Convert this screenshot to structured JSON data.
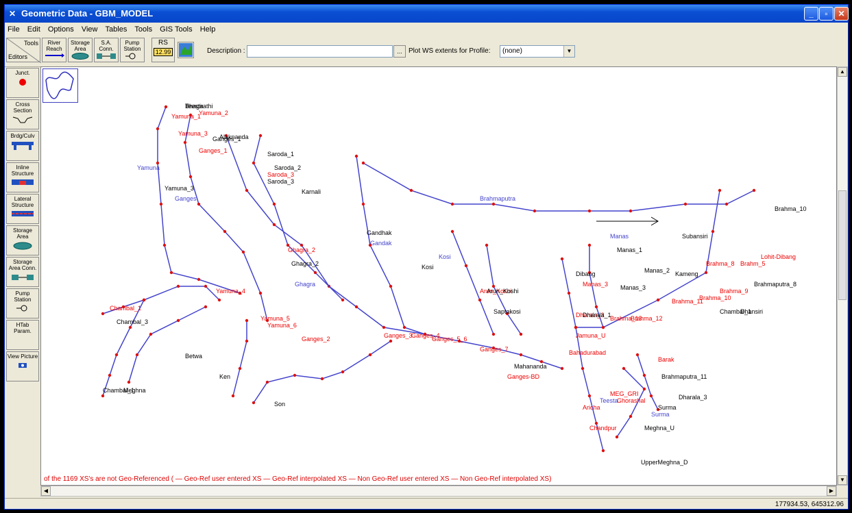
{
  "window": {
    "title": "Geometric Data - GBM_MODEL"
  },
  "menu": [
    "File",
    "Edit",
    "Options",
    "View",
    "Tables",
    "Tools",
    "GIS Tools",
    "Help"
  ],
  "toolbar": {
    "tools_label": "Tools",
    "editors_label": "Editors",
    "river_reach": "River Reach",
    "storage_area": "Storage Area",
    "sa_conn": "S.A. Conn.",
    "pump_station": "Pump Station",
    "rs": "RS",
    "rs_value": "12.99",
    "description_label": "Description :",
    "description_value": "",
    "desc_button": "...",
    "plot_ws_label": "Plot WS extents for Profile:",
    "profile_value": "(none)"
  },
  "sidebar": {
    "junct": "Junct.",
    "cross_section": "Cross Section",
    "brdg_culv": "Brdg/Culv",
    "inline": "Inline Structure",
    "lateral": "Lateral Structure",
    "storage": "Storage Area",
    "storage_conn": "Storage Area Conn.",
    "pump": "Pump Station",
    "htab": "HTab Param.",
    "view_picture": "View Picture"
  },
  "legend": "of the 1169 XS's are not Geo-Referenced ( — Geo-Ref user entered XS  — Geo-Ref interpolated XS  — Non Geo-Ref user entered XS  — Non Geo-Ref interpolated XS)",
  "status": {
    "coords": "177934.53, 645312.96"
  },
  "colors": {
    "river": "#4444cc",
    "xs": "#dd1111",
    "accent": "#0a4fd4"
  },
  "map_labels": {
    "red": [
      "Yamuna_1",
      "Yamuna_2",
      "Yamuna_3",
      "Ganges_1",
      "Saroda_3",
      "Ghagra_2",
      "Yamuna_4",
      "Chambal_1",
      "Yamuna_5",
      "Yamuna_6",
      "Ganges_2",
      "Ganges_3",
      "Ganges_4",
      "Ganges_5_6",
      "Ganges_7",
      "Ganges-BD",
      "Arun_Koshi",
      "Brahma_8",
      "Brahma_9",
      "Brahma_10",
      "Brahma_11",
      "Brahma_12",
      "Manas_3",
      "Dharala_3",
      "Jamuna_U",
      "Bahadurabad",
      "Aricha",
      "Chandpur",
      "Brahm_5",
      "Lohit-Dibang",
      "MEG_GRI",
      "Ghorashal",
      "Barak",
      "Brahma_13"
    ],
    "black": [
      "Bhagirathi",
      "Yamuna_3",
      "Alaknanda",
      "Saroda_1",
      "Saroda_2",
      "Saroda_3",
      "Karnali",
      "Ghagra_2",
      "Chambal_3",
      "Ganges_1",
      "Chambal_1",
      "Betwa",
      "Ken",
      "Son",
      "Gandhak",
      "Kosi",
      "Saptakosi",
      "Arun_Koshi",
      "Mahananda",
      "Manas_1",
      "Manas_2",
      "Manas_3",
      "Kameng",
      "Subansiri",
      "Dhansiri",
      "Brahmaputra_8",
      "Brahma_10",
      "Dibang",
      "Dharala_1",
      "Dharala_3",
      "Surma",
      "Meghna_U",
      "UpperMeghna_D",
      "Meghna",
      "Chambal_1",
      "Brahmaputra_11",
      "Teesta"
    ],
    "blue": [
      "Yamuna",
      "Ganges",
      "Ghagra",
      "Kosi",
      "Brahmaputra",
      "Gandak",
      "Teesta",
      "Manas",
      "Surma"
    ]
  }
}
